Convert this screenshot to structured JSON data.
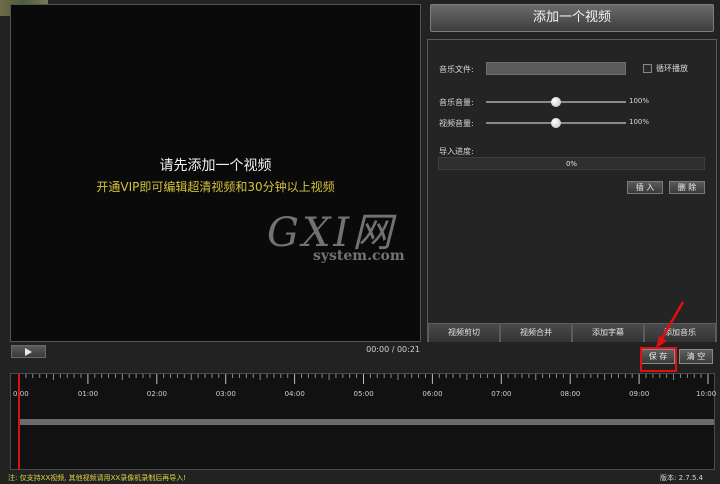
{
  "preview": {
    "title": "请先添加一个视频",
    "vip_note": "开通VIP即可编辑超清视频和30分钟以上视频"
  },
  "player": {
    "time": "00:00 / 00:21"
  },
  "right_panel": {
    "add_video_label": "添加一个视频",
    "music_file_label": "音乐文件:",
    "music_file_value": "",
    "loop_label": "循环播放",
    "loop_checked": false,
    "music_volume_label": "音乐音量:",
    "music_volume_value": "100%",
    "video_volume_label": "视频音量:",
    "video_volume_value": "100%",
    "import_label": "导入进度:",
    "import_progress": "0%",
    "insert_label": "插 入",
    "delete_label": "删 除",
    "tabs": [
      "视频剪切",
      "视频合并",
      "添加字幕",
      "添加音乐"
    ]
  },
  "actions": {
    "save_label": "保 存",
    "clear_label": "清 空"
  },
  "timeline": {
    "ticks": [
      "0:00",
      "01:00",
      "02:00",
      "03:00",
      "04:00",
      "05:00",
      "06:00",
      "07:00",
      "08:00",
      "09:00",
      "10:00"
    ]
  },
  "status": {
    "note": "注: 仅支持XX视频, 其他视频请用XX录像机录制后再导入!",
    "version": "版本: 2.7.5.4"
  },
  "watermark": {
    "big": "GXI网",
    "small": "system.com"
  },
  "colors": {
    "vip_text": "#d4c23a",
    "highlight": "#e01010",
    "playhead": "#d01515"
  }
}
